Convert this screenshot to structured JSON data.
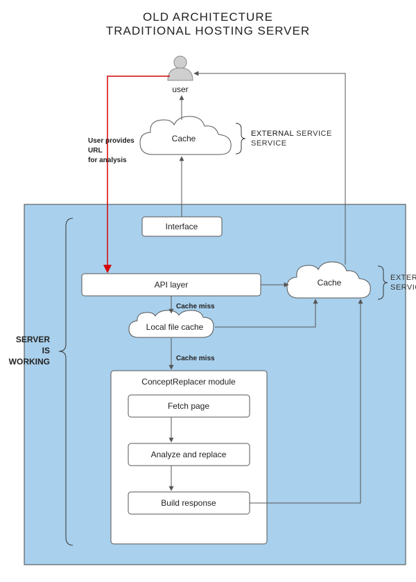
{
  "title": {
    "line1": "OLD ARCHITECTURE",
    "line2": "TRADITIONAL HOSTING SERVER"
  },
  "nodes": {
    "user": "user",
    "cache_top": "Cache",
    "interface": "Interface",
    "api_layer": "API layer",
    "cache_right": "Cache",
    "local_file_cache": "Local file cache",
    "module_title": "ConceptReplacer module",
    "fetch_page": "Fetch page",
    "analyze_replace": "Analyze and replace",
    "build_response": "Build response"
  },
  "labels": {
    "external_service": "EXTERNAL SERVICE",
    "server_is_working_l1": "SERVER",
    "server_is_working_l2": "IS",
    "server_is_working_l3": "WORKING",
    "user_provides_l1": "User provides",
    "user_provides_l2": "URL",
    "user_provides_l3": "for analysis",
    "cache_miss": "Cache miss"
  }
}
